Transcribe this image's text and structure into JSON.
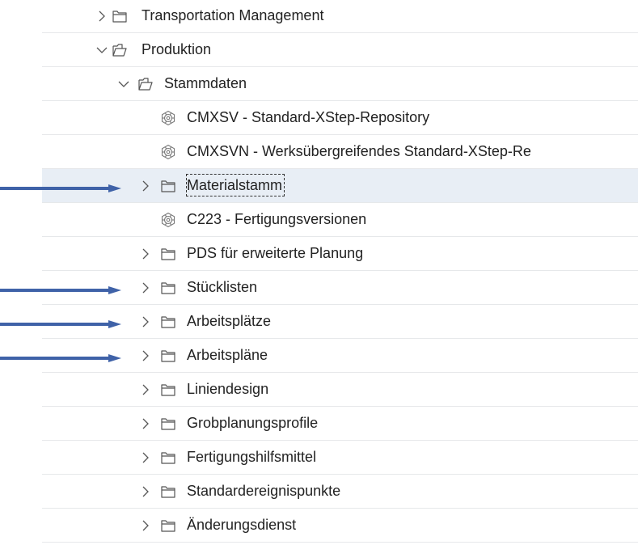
{
  "tree": {
    "items": [
      {
        "label": "Transportation Management",
        "level": 0,
        "type": "folder",
        "expanded": false,
        "selected": false
      },
      {
        "label": "Produktion",
        "level": 0,
        "type": "folder",
        "expanded": true,
        "selected": false
      },
      {
        "label": "Stammdaten",
        "level": 1,
        "type": "folder",
        "expanded": true,
        "selected": false
      },
      {
        "label": "CMXSV - Standard-XStep-Repository",
        "level": 2,
        "type": "transaction",
        "selected": false
      },
      {
        "label": "CMXSVN - Werksübergreifendes Standard-XStep-Re",
        "level": 2,
        "type": "transaction",
        "selected": false
      },
      {
        "label": "Materialstamm",
        "level": 2,
        "type": "folder",
        "expanded": false,
        "selected": true,
        "marked": true
      },
      {
        "label": "C223 - Fertigungsversionen",
        "level": 2,
        "type": "transaction",
        "selected": false
      },
      {
        "label": "PDS für erweiterte Planung",
        "level": 2,
        "type": "folder",
        "expanded": false,
        "selected": false
      },
      {
        "label": "Stücklisten",
        "level": 2,
        "type": "folder",
        "expanded": false,
        "selected": false,
        "marked": true
      },
      {
        "label": "Arbeitsplätze",
        "level": 2,
        "type": "folder",
        "expanded": false,
        "selected": false,
        "marked": true
      },
      {
        "label": "Arbeitspläne",
        "level": 2,
        "type": "folder",
        "expanded": false,
        "selected": false,
        "marked": true
      },
      {
        "label": "Liniendesign",
        "level": 2,
        "type": "folder",
        "expanded": false,
        "selected": false
      },
      {
        "label": "Grobplanungsprofile",
        "level": 2,
        "type": "folder",
        "expanded": false,
        "selected": false
      },
      {
        "label": "Fertigungshilfsmittel",
        "level": 2,
        "type": "folder",
        "expanded": false,
        "selected": false
      },
      {
        "label": "Standardereignispunkte",
        "level": 2,
        "type": "folder",
        "expanded": false,
        "selected": false
      },
      {
        "label": "Änderungsdienst",
        "level": 2,
        "type": "folder",
        "expanded": false,
        "selected": false
      }
    ]
  },
  "colors": {
    "arrow": "#3f62a8",
    "selected_row": "#e8eef5",
    "icon": "#555555"
  }
}
